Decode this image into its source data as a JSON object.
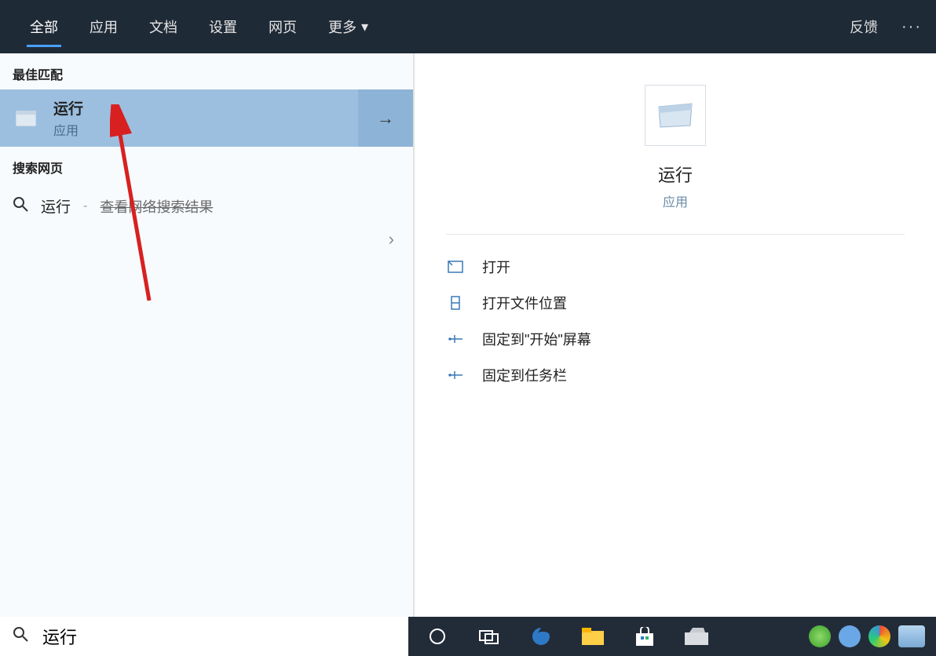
{
  "topbar": {
    "tabs": {
      "all": "全部",
      "apps": "应用",
      "docs": "文档",
      "settings": "设置",
      "web": "网页",
      "more": "更多"
    },
    "feedback": "反馈"
  },
  "left": {
    "section_best": "最佳匹配",
    "result": {
      "title": "运行",
      "sub": "应用"
    },
    "section_web": "搜索网页",
    "web_result": {
      "term": "运行",
      "sub": "查看网络搜索结果"
    }
  },
  "detail": {
    "title": "运行",
    "sub": "应用",
    "actions": {
      "open": "打开",
      "open_location": "打开文件位置",
      "pin_start": "固定到\"开始\"屏幕",
      "pin_taskbar": "固定到任务栏"
    }
  },
  "search": {
    "value": "运行"
  }
}
